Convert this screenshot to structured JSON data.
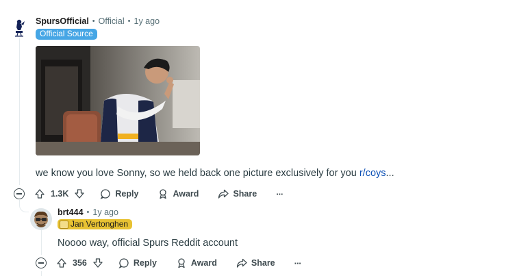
{
  "comment1": {
    "author": "SpursOfficial",
    "role": "Official",
    "age": "1y ago",
    "flair": "Official Source",
    "body_text": "we know you love Sonny, so we held back one picture exclusively for you ",
    "body_link": "r/coys",
    "body_suffix": "...",
    "votes": "1.3K",
    "reply_label": "Reply",
    "award_label": "Award",
    "share_label": "Share",
    "more_label": "···"
  },
  "comment2": {
    "author": "brt444",
    "age": "1y ago",
    "flair": "Jan Vertonghen",
    "body_text": "Noooo way, official Spurs Reddit account",
    "votes": "356",
    "reply_label": "Reply",
    "award_label": "Award",
    "share_label": "Share",
    "more_label": "···"
  },
  "colors": {
    "official_flair": "#46a6e5",
    "user_flair": "#e8c233",
    "link": "#0a4fb5"
  }
}
